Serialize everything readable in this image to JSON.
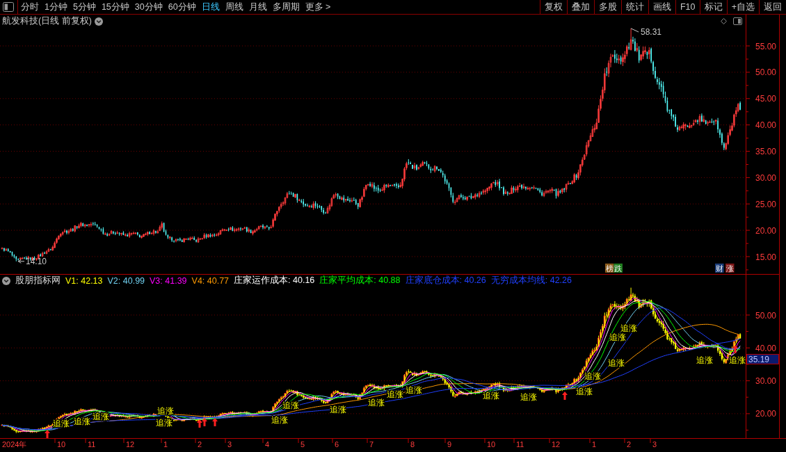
{
  "toolbar": {
    "periods": [
      {
        "label": "分时",
        "selected": false
      },
      {
        "label": "1分钟",
        "selected": false
      },
      {
        "label": "5分钟",
        "selected": false
      },
      {
        "label": "15分钟",
        "selected": false
      },
      {
        "label": "30分钟",
        "selected": false
      },
      {
        "label": "60分钟",
        "selected": false
      },
      {
        "label": "日线",
        "selected": true
      },
      {
        "label": "周线",
        "selected": false
      },
      {
        "label": "月线",
        "selected": false
      },
      {
        "label": "多周期",
        "selected": false
      },
      {
        "label": "更多 >",
        "selected": false
      }
    ],
    "actions": [
      "复权",
      "叠加",
      "多股",
      "统计",
      "画线",
      "F10",
      "标记",
      "+自选",
      "返回"
    ]
  },
  "chart_title": "航发科技(日线 前复权)",
  "price_panel": {
    "axis_labels": [
      "55.00",
      "50.00",
      "45.00",
      "40.00",
      "35.00",
      "30.00",
      "25.00",
      "20.00",
      "15.00"
    ],
    "high_label": "58.31",
    "low_label": "14.10",
    "events": [
      {
        "text": "榜",
        "color": "#8a5a1c"
      },
      {
        "text": "跌",
        "color": "#1f7d1f"
      },
      {
        "text": "财",
        "color": "#1b3d7a"
      },
      {
        "text": "涨",
        "color": "#7d1616"
      }
    ]
  },
  "indicator_panel": {
    "name": "股朋指标网",
    "legend": [
      {
        "text": "V1: 42.13",
        "color": "#ffff00"
      },
      {
        "text": "V2: 40.99",
        "color": "#70d0f0"
      },
      {
        "text": "V3: 41.39",
        "color": "#ff00ff"
      },
      {
        "text": "V4: 40.77",
        "color": "#ff9a00"
      },
      {
        "text": "庄家运作成本: 40.16",
        "color": "#ffffff"
      },
      {
        "text": "庄家平均成本: 40.88",
        "color": "#00ff00"
      },
      {
        "text": "庄家底仓成本: 40.26",
        "color": "#2040ff"
      },
      {
        "text": "无穷成本均线: 42.26",
        "color": "#2040ff"
      }
    ],
    "axis_labels": [
      "50.00",
      "40.00",
      "30.00",
      "20.00"
    ],
    "current_value": "35.19",
    "signals": [
      "追涨",
      "追涨",
      "追涨",
      "追涨",
      "追涨",
      "追涨",
      "追涨",
      "追涨",
      "追涨",
      "追涨",
      "追涨",
      "追涨",
      "追涨",
      "追涨",
      "追涨",
      "追涨",
      "追涨",
      "追涨",
      "追涨",
      "追涨"
    ]
  },
  "time_axis": [
    "2024年",
    "10",
    "11",
    "12",
    "1",
    "2",
    "3",
    "4",
    "5",
    "6",
    "7",
    "8",
    "9",
    "10",
    "11",
    "12",
    "1",
    "2",
    "3"
  ]
}
